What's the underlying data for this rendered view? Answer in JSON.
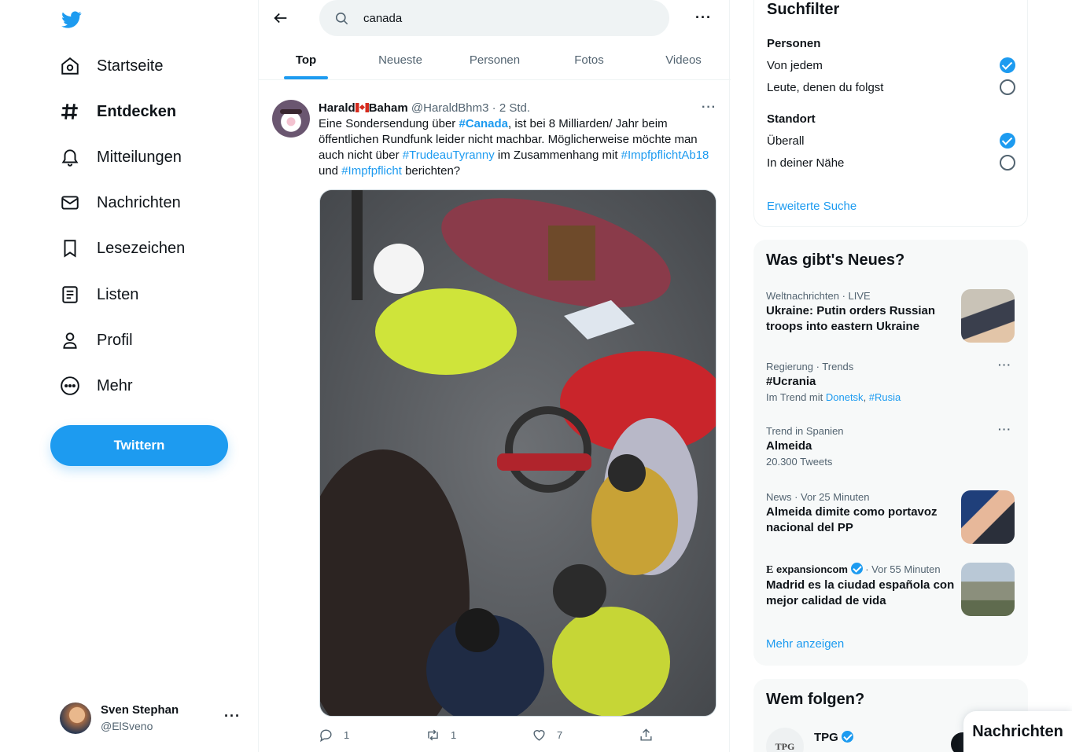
{
  "nav": {
    "items": [
      {
        "label": "Startseite",
        "icon": "home-icon"
      },
      {
        "label": "Entdecken",
        "icon": "hashtag-icon",
        "active": true
      },
      {
        "label": "Mitteilungen",
        "icon": "bell-icon"
      },
      {
        "label": "Nachrichten",
        "icon": "envelope-icon"
      },
      {
        "label": "Lesezeichen",
        "icon": "bookmark-icon"
      },
      {
        "label": "Listen",
        "icon": "list-icon"
      },
      {
        "label": "Profil",
        "icon": "person-icon"
      },
      {
        "label": "Mehr",
        "icon": "more-circle-icon"
      }
    ],
    "tweet_button": "Twittern"
  },
  "account": {
    "name": "Sven Stephan",
    "handle": "@ElSveno",
    "more": "···"
  },
  "search": {
    "value": "canada",
    "more": "···"
  },
  "tabs": [
    "Top",
    "Neueste",
    "Personen",
    "Fotos",
    "Videos"
  ],
  "tweet": {
    "name_first": "Harald",
    "name_last": "Baham",
    "handle": "@HaraldBhm3",
    "time": "· 2 Std.",
    "more": "···",
    "text_1": "Eine Sondersendung über ",
    "tag_canada": "#Canada",
    "text_2": ", ist bei 8 Milliarden/ Jahr beim öffentlichen Rundfunk leider nicht machbar. Möglicherweise möchte man auch nicht über ",
    "tag_trudeau": "#TrudeauTyranny",
    "text_3": " im Zusammenhang mit ",
    "tag_impf18": "#ImpfpflichtAb18",
    "text_4": " und ",
    "tag_impf": "#Impfpflicht",
    "text_5": " berichten?",
    "replies": "1",
    "retweets": "1",
    "likes": "7"
  },
  "filter": {
    "title": "Suchfilter",
    "people_label": "Personen",
    "people_opt1": "Von jedem",
    "people_opt2": "Leute, denen du folgst",
    "location_label": "Standort",
    "location_opt1": "Überall",
    "location_opt2": "In deiner Nähe",
    "advanced": "Erweiterte Suche"
  },
  "trends": {
    "title": "Was gibt's Neues?",
    "t1_meta": "Weltnachrichten · LIVE",
    "t1_title": "Ukraine: Putin orders Russian troops into eastern Ukraine",
    "t2_meta": "Regierung · Trends",
    "t2_title": "#Ucrania",
    "t2_sub_prefix": "Im Trend mit ",
    "t2_link1": "Donetsk",
    "t2_sep": ", ",
    "t2_link2": "#Rusia",
    "t3_meta": "Trend in Spanien",
    "t3_title": "Almeida",
    "t3_sub": "20.300 Tweets",
    "t4_meta": "News · Vor 25 Minuten",
    "t4_title": "Almeida dimite como portavoz nacional del PP",
    "t5_logo": "E",
    "t5_source": "expansioncom",
    "t5_time": " · Vor 55 Minuten",
    "t5_title": "Madrid es la ciudad española con mejor calidad de vida",
    "dots": "···",
    "show_more": "Mehr anzeigen"
  },
  "follow": {
    "title": "Wem folgen?",
    "name": "TPG",
    "avatar_text": "TPG"
  },
  "messages_drawer": "Nachrichten",
  "colors": {
    "accent": "#1d9bf0",
    "text": "#0f1419",
    "secondary": "#536471"
  }
}
